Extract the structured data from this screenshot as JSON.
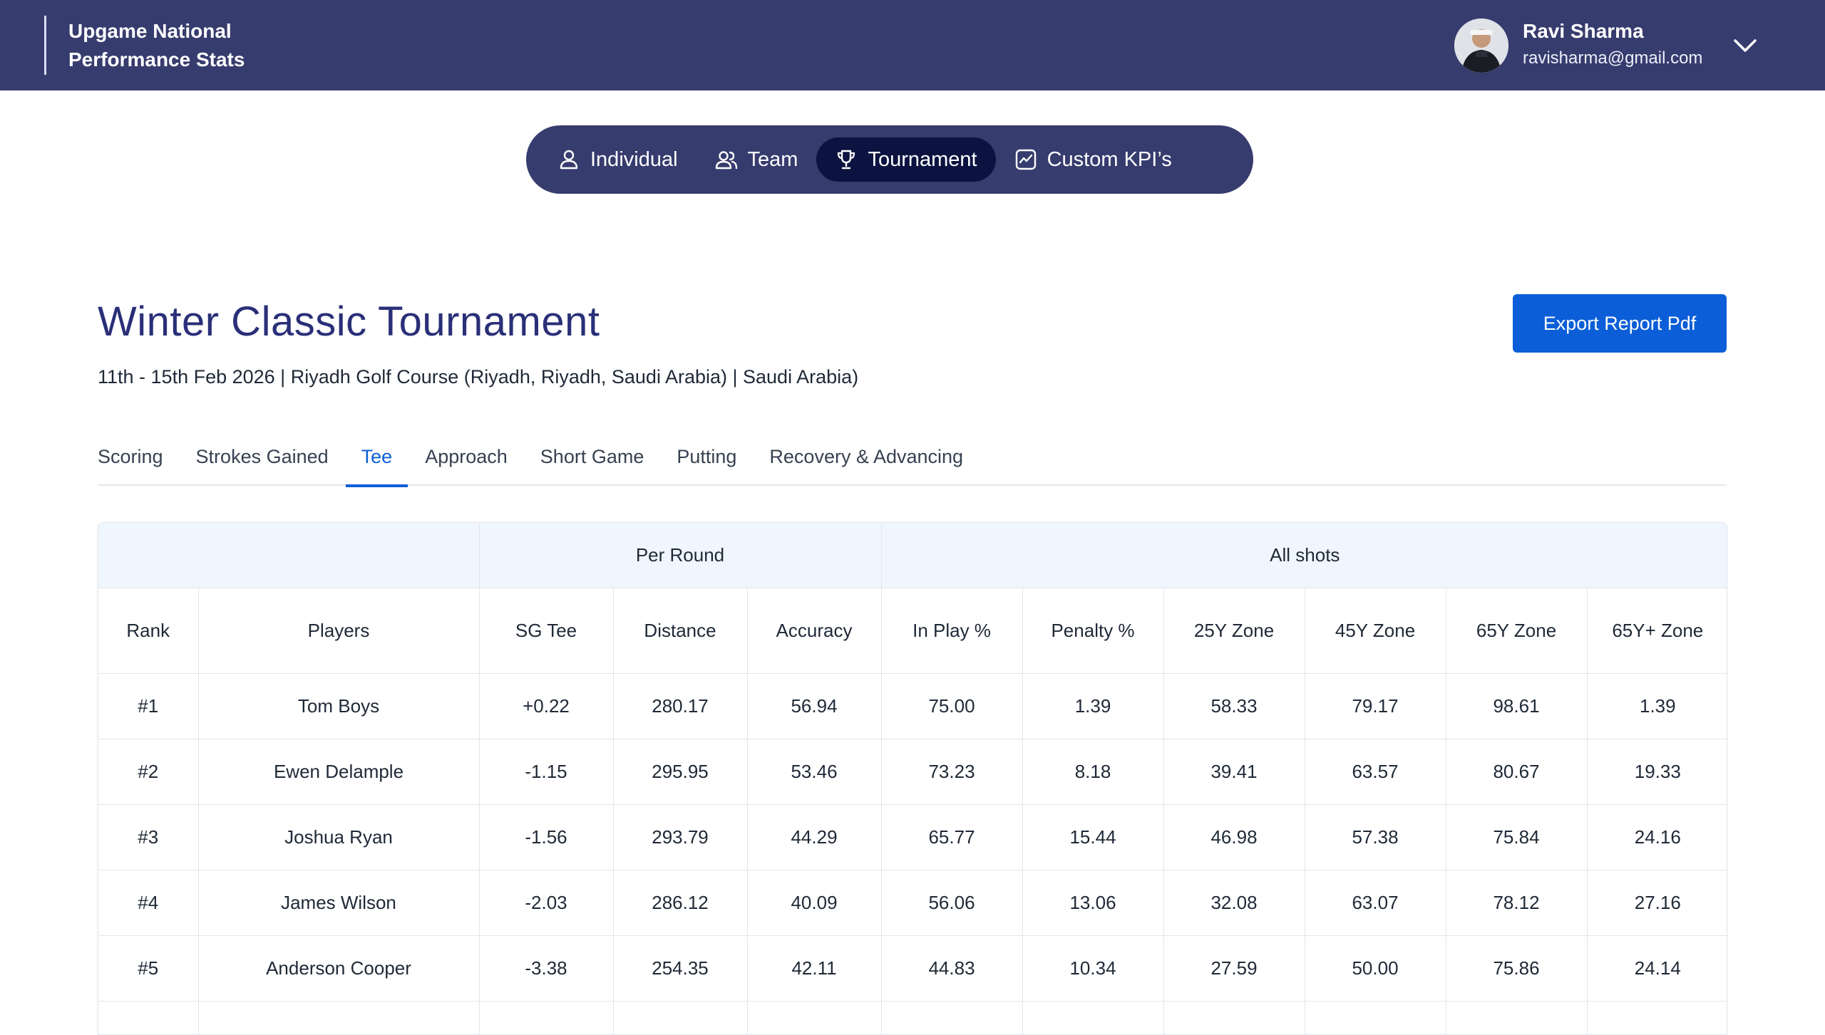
{
  "header": {
    "brand_line1": "Upgame National",
    "brand_line2": "Performance Stats",
    "user_name": "Ravi Sharma",
    "user_email": "ravisharma@gmail.com"
  },
  "nav": {
    "items": [
      {
        "label": "Individual",
        "icon": "user-icon",
        "active": false
      },
      {
        "label": "Team",
        "icon": "users-icon",
        "active": false
      },
      {
        "label": "Tournament",
        "icon": "trophy-icon",
        "active": true
      },
      {
        "label": "Custom KPI’s",
        "icon": "chart-icon",
        "active": false
      }
    ]
  },
  "page": {
    "title": "Winter Classic Tournament",
    "subtitle": "11th - 15th Feb 2026 | Riyadh Golf Course (Riyadh, Riyadh, Saudi Arabia) | Saudi Arabia)",
    "export_label": "Export Report Pdf"
  },
  "tabs": [
    {
      "label": "Scoring",
      "active": false
    },
    {
      "label": "Strokes Gained",
      "active": false
    },
    {
      "label": "Tee",
      "active": true
    },
    {
      "label": "Approach",
      "active": false
    },
    {
      "label": "Short Game",
      "active": false
    },
    {
      "label": "Putting",
      "active": false
    },
    {
      "label": "Recovery & Advancing",
      "active": false
    }
  ],
  "table": {
    "groups": {
      "per_round": "Per Round",
      "all_shots": "All shots"
    },
    "columns": [
      "Rank",
      "Players",
      "SG Tee",
      "Distance",
      "Accuracy",
      "In Play %",
      "Penalty %",
      "25Y Zone",
      "45Y Zone",
      "65Y Zone",
      "65Y+ Zone"
    ],
    "rows": [
      [
        "#1",
        "Tom Boys",
        "+0.22",
        "280.17",
        "56.94",
        "75.00",
        "1.39",
        "58.33",
        "79.17",
        "98.61",
        "1.39"
      ],
      [
        "#2",
        "Ewen Delample",
        "-1.15",
        "295.95",
        "53.46",
        "73.23",
        "8.18",
        "39.41",
        "63.57",
        "80.67",
        "19.33"
      ],
      [
        "#3",
        "Joshua Ryan",
        "-1.56",
        "293.79",
        "44.29",
        "65.77",
        "15.44",
        "46.98",
        "57.38",
        "75.84",
        "24.16"
      ],
      [
        "#4",
        "James Wilson",
        "-2.03",
        "286.12",
        "40.09",
        "56.06",
        "13.06",
        "32.08",
        "63.07",
        "78.12",
        "27.16"
      ],
      [
        "#5",
        "Anderson Cooper",
        "-3.38",
        "254.35",
        "42.11",
        "44.83",
        "10.34",
        "27.59",
        "50.00",
        "75.86",
        "24.14"
      ],
      [
        "",
        "",
        "",
        "",
        "",
        "",
        "",
        "",
        "",
        "",
        ""
      ]
    ]
  }
}
